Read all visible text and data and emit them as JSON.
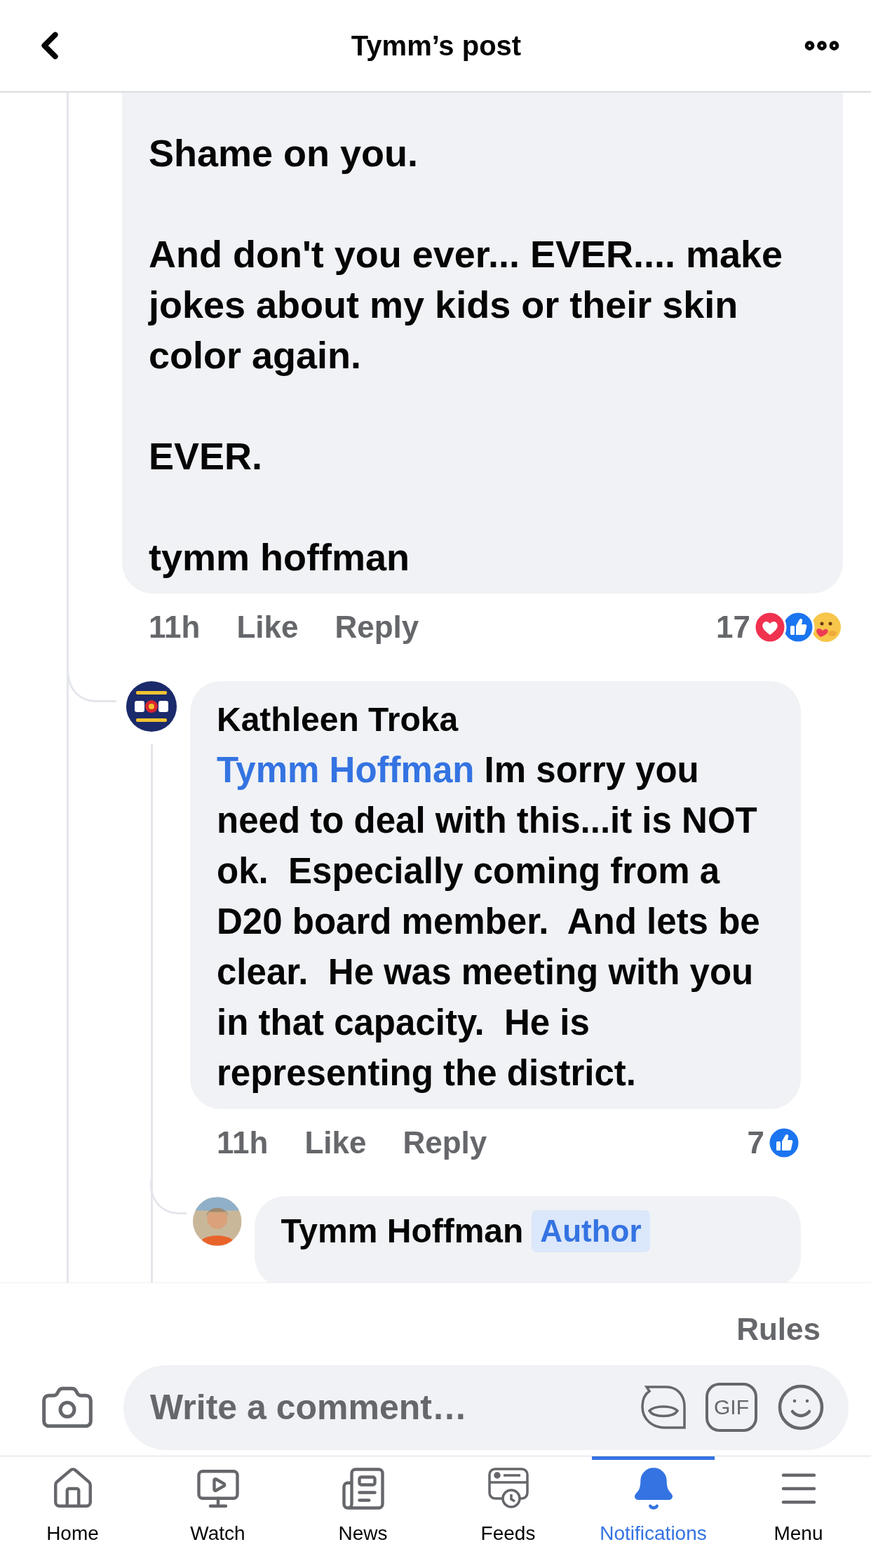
{
  "header": {
    "title": "Tymm’s post"
  },
  "comments": [
    {
      "paragraphs": [
        "Shame on you.",
        "And don't you ever... EVER.... make jokes about my kids or their skin color again.",
        "EVER.",
        "tymm hoffman"
      ],
      "time": "11h",
      "like": "Like",
      "reply": "Reply",
      "reaction_count": "17",
      "reactions": [
        {
          "kind": "love"
        },
        {
          "kind": "like"
        },
        {
          "kind": "care"
        }
      ],
      "replies": [
        {
          "author": "Kathleen Troka",
          "mention": "Tymm Hoffman",
          "text": " Im sorry you need to deal with this...it is NOT ok.  Especially coming from a  D20 board member.  And lets be clear.  He was meeting with you in that capacity.  He is representing the district.",
          "time": "11h",
          "like": "Like",
          "reply": "Reply",
          "reaction_count": "7",
          "reactions": [
            {
              "kind": "like"
            }
          ],
          "replies": [
            {
              "author": "Tymm Hoffman",
              "badge": "Author"
            }
          ]
        }
      ]
    }
  ],
  "rules": "Rules",
  "composer": {
    "placeholder": "Write a comment…",
    "gif": "GIF"
  },
  "tabs": [
    {
      "kind": "home",
      "label": "Home",
      "selected": false
    },
    {
      "kind": "watch",
      "label": "Watch",
      "selected": false
    },
    {
      "kind": "news",
      "label": "News",
      "selected": false
    },
    {
      "kind": "feeds",
      "label": "Feeds",
      "selected": false
    },
    {
      "kind": "notifications",
      "label": "Notifications",
      "selected": true
    },
    {
      "kind": "menu",
      "label": "Menu",
      "selected": false
    }
  ]
}
